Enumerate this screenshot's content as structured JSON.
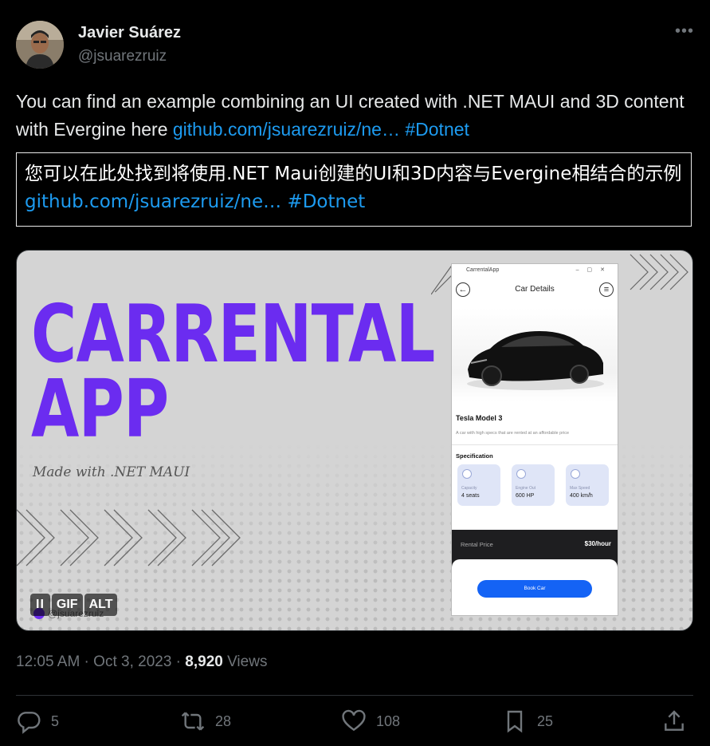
{
  "author": {
    "name": "Javier Suárez",
    "handle": "@jsuarezruiz"
  },
  "more_label": "•••",
  "tweet": {
    "text_before": "You can find an example combining an UI created with .NET MAUI and 3D content with Evergine here ",
    "link": "github.com/jsuarezruiz/ne…",
    "hashtag": "#Dotnet"
  },
  "translation": {
    "text": "您可以在此处找到将使用.NET Maui创建的UI和3D内容与Evergine相结合的示例 ",
    "link": "github.com/jsuarezruiz/ne…",
    "hashtag": "#Dotnet"
  },
  "media": {
    "title_line1": "CARRENTAL",
    "title_line2": "APP",
    "subtitle": "Made with .NET MAUI",
    "watermark": "@jsuarezruiz",
    "badges": {
      "pause": "II",
      "gif": "GIF",
      "alt": "ALT"
    },
    "phone": {
      "window_title": "CarrentalApp",
      "page_title": "Car Details",
      "model": "Tesla Model 3",
      "description": "A car with high specs that are rented at an affordable price",
      "spec_title": "Specification",
      "specs": [
        {
          "label": "Capacity",
          "value": "4 seats"
        },
        {
          "label": "Engine Out",
          "value": "600 HP"
        },
        {
          "label": "Max Speed",
          "value": "400 km/h"
        }
      ],
      "rental_label": "Rental Price",
      "rental_value": "$30/hour",
      "book_label": "Book Car"
    }
  },
  "meta": {
    "time_date": "12:05 AM · Oct 3, 2023 · ",
    "views_count": "8,920",
    "views_label": " Views"
  },
  "actions": {
    "replies": "5",
    "reposts": "28",
    "likes": "108",
    "bookmarks": "25"
  },
  "colors": {
    "accent": "#1d9bf0",
    "brand_purple": "#6b2cf0",
    "book_blue": "#1463f5"
  }
}
